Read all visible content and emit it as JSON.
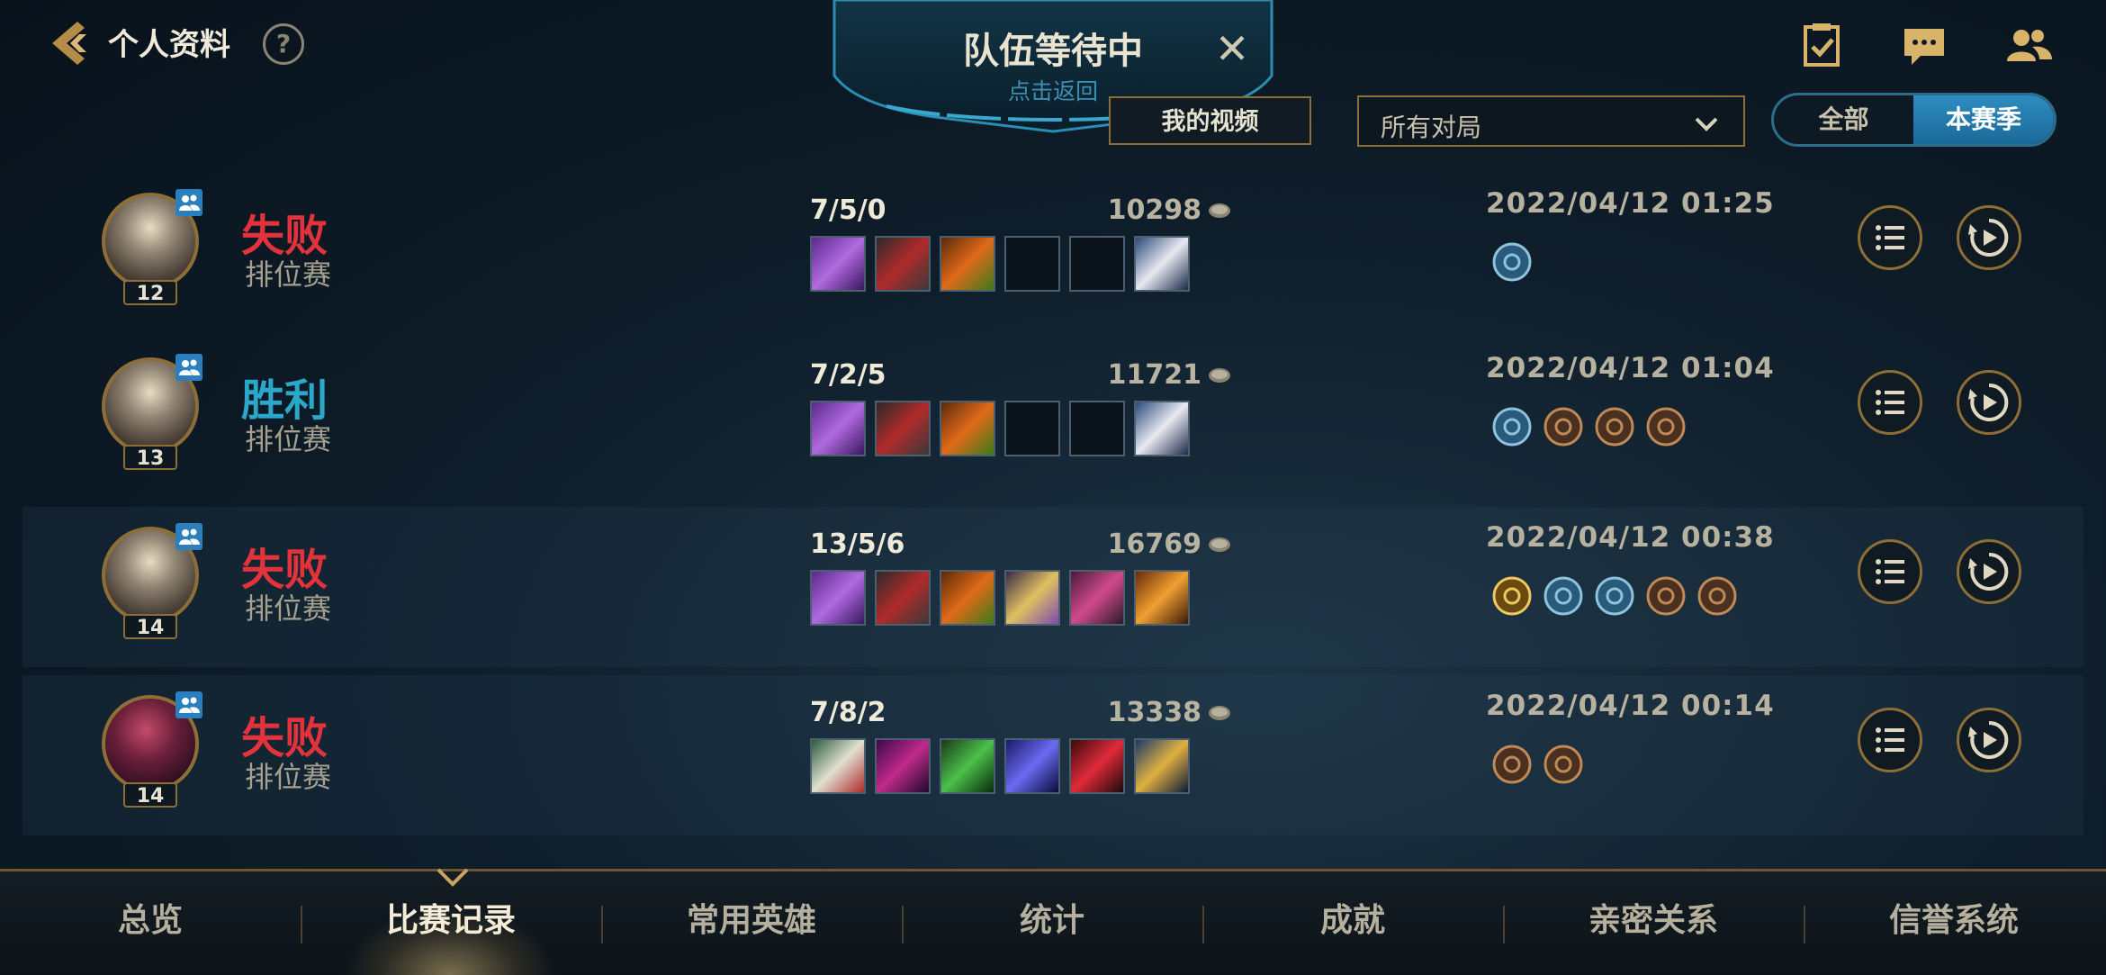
{
  "header": {
    "title": "个人资料",
    "help_symbol": "?",
    "icons": [
      "task-icon",
      "chat-icon",
      "friends-icon"
    ]
  },
  "queue_banner": {
    "title": "队伍等待中",
    "subtitle": "点击返回",
    "close_symbol": "✕"
  },
  "filters": {
    "my_videos": "我的视频",
    "match_type": "所有对局",
    "season_all": "全部",
    "season_current": "本赛季",
    "season_selected": "本赛季"
  },
  "matches": [
    {
      "result": "失败",
      "outcome": "loss",
      "mode": "排位赛",
      "level": "12",
      "kda": "7/5/0",
      "gold": "10298",
      "date": "2022/04/12 01:25",
      "portrait": "a1",
      "items": [
        "purple",
        "red",
        "fire",
        "empty",
        "empty",
        "boot"
      ],
      "runes": [
        "blue-shield"
      ]
    },
    {
      "result": "胜利",
      "outcome": "win",
      "mode": "排位赛",
      "level": "13",
      "kda": "7/2/5",
      "gold": "11721",
      "date": "2022/04/12 01:04",
      "portrait": "a1",
      "items": [
        "purple",
        "red",
        "fire",
        "empty",
        "empty",
        "boot"
      ],
      "runes": [
        "blue-sword",
        "bronze-tower",
        "bronze-leaf",
        "bronze-drop"
      ]
    },
    {
      "result": "失败",
      "outcome": "loss",
      "mode": "排位赛",
      "level": "14",
      "kda": "13/5/6",
      "gold": "16769",
      "date": "2022/04/12 00:38",
      "portrait": "a1",
      "items": [
        "purple",
        "red",
        "fire",
        "gold",
        "pink",
        "orange"
      ],
      "runes": [
        "gold-a",
        "blue-sword",
        "blue-shield",
        "bronze-wing",
        "bronze-drop"
      ]
    },
    {
      "result": "失败",
      "outcome": "loss",
      "mode": "排位赛",
      "level": "14",
      "kda": "7/8/2",
      "gold": "13338",
      "date": "2022/04/12 00:14",
      "portrait": "a2",
      "items": [
        "mask",
        "dark",
        "green",
        "staff",
        "gem",
        "blue-gold"
      ],
      "runes": [
        "bronze-fist",
        "bronze-wing"
      ]
    }
  ],
  "nav": {
    "tabs": [
      "总览",
      "比赛记录",
      "常用英雄",
      "统计",
      "成就",
      "亲密关系",
      "信誉系统"
    ],
    "active": "比赛记录"
  },
  "colors": {
    "loss": "#e2333c",
    "win": "#2ba7c9",
    "gold_border": "#8e6e37",
    "accent_blue": "#2f8cc0"
  }
}
